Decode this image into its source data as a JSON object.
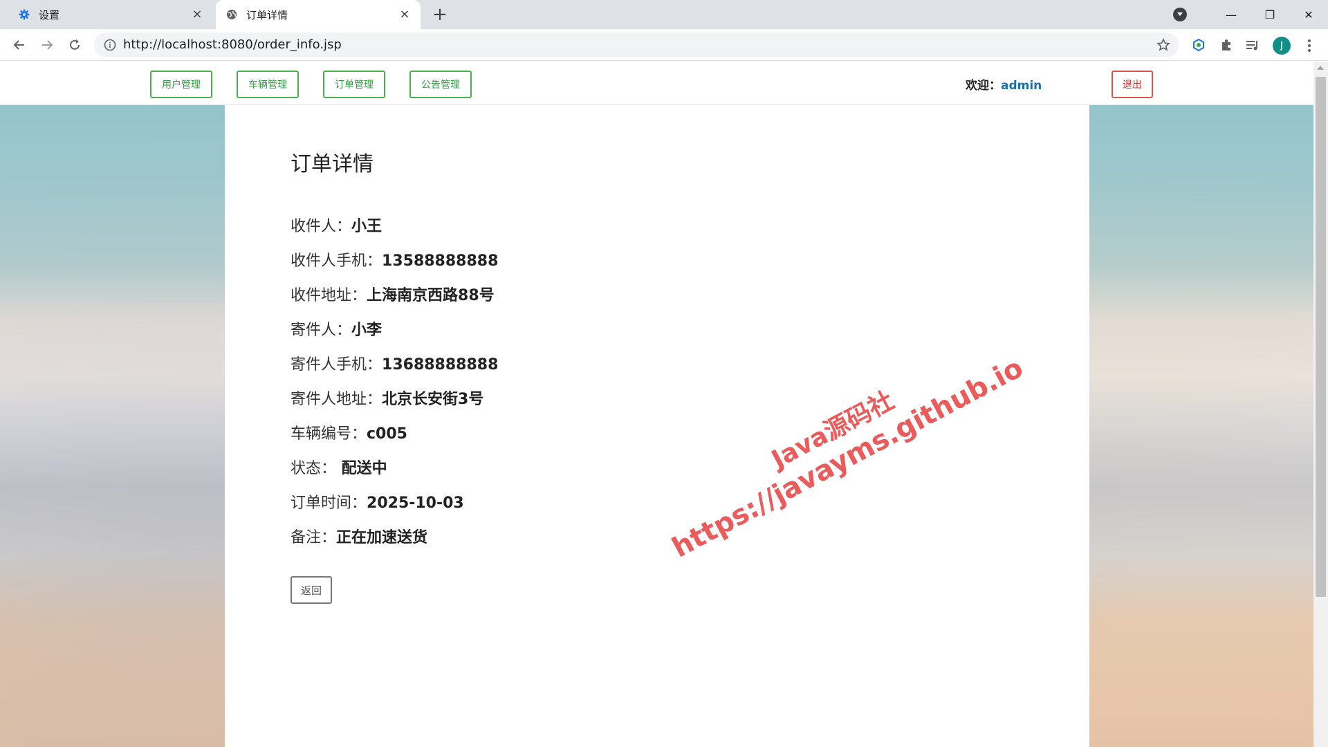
{
  "browser": {
    "tabs": [
      {
        "title": "设置",
        "icon": "gear-icon",
        "active": false
      },
      {
        "title": "订单详情",
        "icon": "globe-icon",
        "active": true
      }
    ],
    "url": "http://localhost:8080/order_info.jsp",
    "profile_initial": "J"
  },
  "nav": {
    "links": [
      "用户管理",
      "车辆管理",
      "订单管理",
      "公告管理"
    ],
    "welcome_label": "欢迎：",
    "username": "admin",
    "logout_label": "退出"
  },
  "order": {
    "heading": "订单详情",
    "fields": [
      {
        "label": "收件人：",
        "value": "小王"
      },
      {
        "label": "收件人手机：",
        "value": "13588888888"
      },
      {
        "label": "收件地址：",
        "value": "上海南京西路88号"
      },
      {
        "label": "寄件人：",
        "value": "小李"
      },
      {
        "label": "寄件人手机：",
        "value": "13688888888"
      },
      {
        "label": "寄件人地址：",
        "value": "北京长安街3号"
      },
      {
        "label": "车辆编号：",
        "value": "c005"
      },
      {
        "label": "状态：",
        "value": " 配送中"
      },
      {
        "label": "订单时间：",
        "value": "2025-10-03"
      },
      {
        "label": "备注：",
        "value": "正在加速送货"
      }
    ],
    "back_label": "返回"
  },
  "watermark": {
    "line1": "Java源码社",
    "line2": "https://javayms.github.io"
  },
  "colors": {
    "nav_green": "#4caf50",
    "logout_red": "#d9534f",
    "username_blue": "#1f6fa5",
    "watermark_red": "#e84a4a"
  }
}
